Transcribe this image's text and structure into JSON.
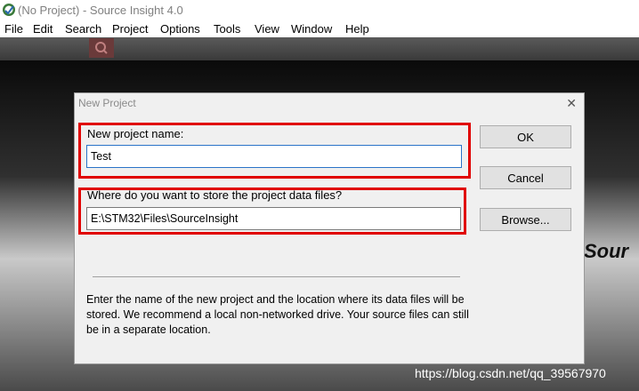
{
  "window": {
    "title": "(No Project) - Source Insight 4.0"
  },
  "menu": [
    "File",
    "Edit",
    "Search",
    "Project",
    "Options",
    "Tools",
    "View",
    "Window",
    "Help"
  ],
  "background": {
    "splash_text": "Sour",
    "watermark": "https://blog.csdn.net/qq_39567970"
  },
  "dialog": {
    "title": "New Project",
    "close_glyph": "✕",
    "name_label": "New project name:",
    "name_value": "Test",
    "location_label": "Where do you want to store the project data files?",
    "location_value": "E:\\STM32\\Files\\SourceInsight",
    "ok_label": "OK",
    "cancel_label": "Cancel",
    "browse_label": "Browse...",
    "description": "Enter the name of the new project and the location where its data files will be stored. We recommend a local non-networked drive. Your source files can still be in a separate location."
  },
  "colors": {
    "highlight": "#e00000",
    "focus_border": "#2a73c8"
  }
}
